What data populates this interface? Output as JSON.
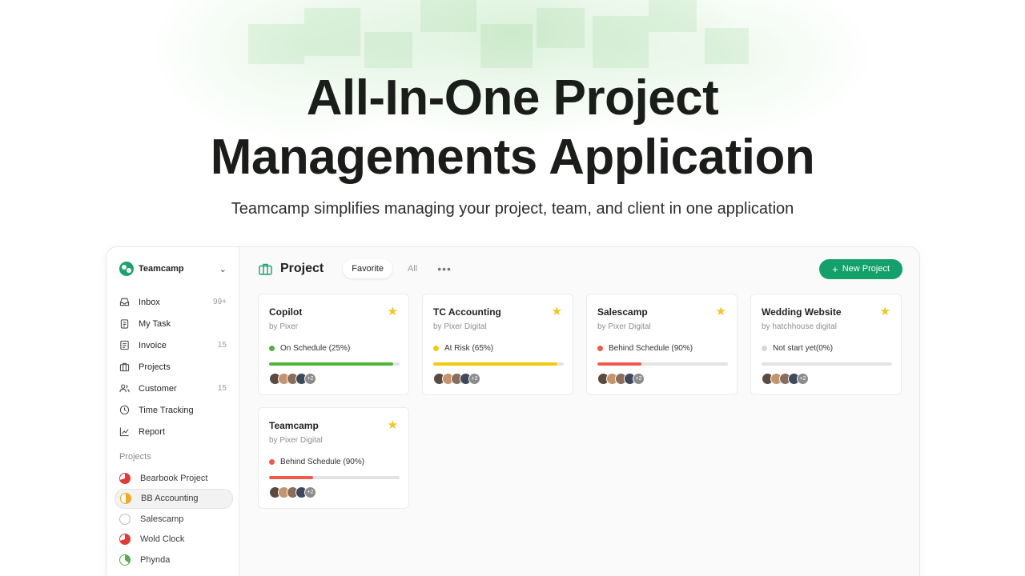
{
  "hero": {
    "title_line1": "All-In-One Project",
    "title_line2": "Managements Application",
    "subtitle": "Teamcamp simplifies managing your project, team, and client in one application"
  },
  "sidebar": {
    "workspace": {
      "name": "Teamcamp",
      "logo_icon": "teamcamp-logo-icon",
      "chevron_icon": "chevron-down-icon"
    },
    "nav": [
      {
        "label": "Inbox",
        "count": "99+",
        "icon": "inbox-icon"
      },
      {
        "label": "My Task",
        "count": "",
        "icon": "clipboard-icon"
      },
      {
        "label": "Invoice",
        "count": "15",
        "icon": "invoice-icon"
      },
      {
        "label": "Projects",
        "count": "",
        "icon": "briefcase-icon"
      },
      {
        "label": "Customer",
        "count": "15",
        "icon": "users-icon"
      },
      {
        "label": "Time Tracking",
        "count": "",
        "icon": "clock-icon"
      },
      {
        "label": "Report",
        "count": "",
        "icon": "chart-icon"
      }
    ],
    "projects_heading": "Projects",
    "projects": [
      {
        "label": "Bearbook Project",
        "color": "#e53935"
      },
      {
        "label": "BB Accounting",
        "color": "#f5a623"
      },
      {
        "label": "Salescamp",
        "color": "#cfcfcf"
      },
      {
        "label": "Wold Clock",
        "color": "#e53935"
      },
      {
        "label": "Phynda",
        "color": "#4caf50"
      }
    ]
  },
  "main": {
    "title": "Project",
    "tabs": [
      "Favorite",
      "All"
    ],
    "more_icon": "more-horizontal-icon",
    "new_button": "New Project",
    "cards": [
      {
        "title": "Copilot",
        "by": "by Pixer",
        "status": "On Schedule (25%)",
        "status_color": "#52b33b",
        "progress": 0.95,
        "more": "+2"
      },
      {
        "title": "TC Accounting",
        "by": "by Pixer Digital",
        "status": "At Risk (65%)",
        "status_color": "#f2cc0c",
        "progress": 0.95,
        "more": "+2"
      },
      {
        "title": "Salescamp",
        "by": "by Pixer Digital",
        "status": "Behind Schedule (90%)",
        "status_color": "#ee5b4b",
        "progress": 0.34,
        "more": "+2"
      },
      {
        "title": "Wedding Website",
        "by": "by hatchhouse digital",
        "status": "Not start yet(0%)",
        "status_color": "#d5d5d5",
        "progress": 0,
        "more": "+2"
      },
      {
        "title": "Teamcamp",
        "by": "by Pixer Digital",
        "status": "Behind Schedule (90%)",
        "status_color": "#ee5b4b",
        "progress": 0.34,
        "more": "+2"
      }
    ]
  }
}
